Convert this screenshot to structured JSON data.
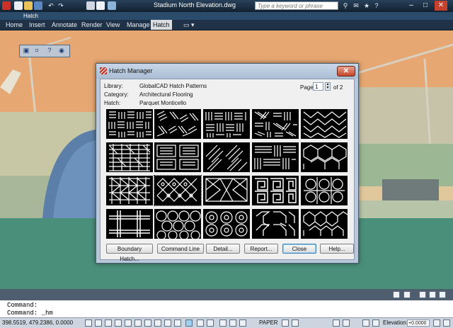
{
  "app": {
    "document_title": "Stadium North Elevation.dwg",
    "search_placeholder": "Type a keyword or phrase",
    "workspace_tab": "Hatch",
    "window_min": "–",
    "window_max": "□",
    "window_close": "✕"
  },
  "ribbon": {
    "tabs": [
      "Home",
      "Insert",
      "Annotate",
      "Render",
      "View",
      "Manage",
      "Hatch"
    ],
    "active_tab": "Hatch",
    "extra": "▭ ▾"
  },
  "dialog": {
    "title": "Hatch Manager",
    "close_glyph": "✕",
    "library_label": "Library:",
    "library_value": "GlobalCAD Hatch Patterns",
    "category_label": "Category:",
    "category_value": "Architectural Flooring",
    "hatch_label": "Hatch:",
    "hatch_value": "Parquet Monticello",
    "page_label": "Page",
    "page_value": "1",
    "page_of": "of 2",
    "buttons": {
      "boundary": "Boundary Hatch...",
      "command_line": "Command Line",
      "detail": "Detail...",
      "report": "Report...",
      "close": "Close",
      "help": "Help..."
    }
  },
  "command": {
    "line1": "Command:",
    "line2": "Command:  _hm"
  },
  "status": {
    "coordinates": "398.5519, 479.2386, 0.0000",
    "paper": "PAPER",
    "elevation_label": "Elevation:",
    "elevation_value": "+0.0000"
  },
  "colors": {
    "accent": "#2b4b6a",
    "ground": "#4a8f79",
    "sky": "#e9a86c"
  }
}
